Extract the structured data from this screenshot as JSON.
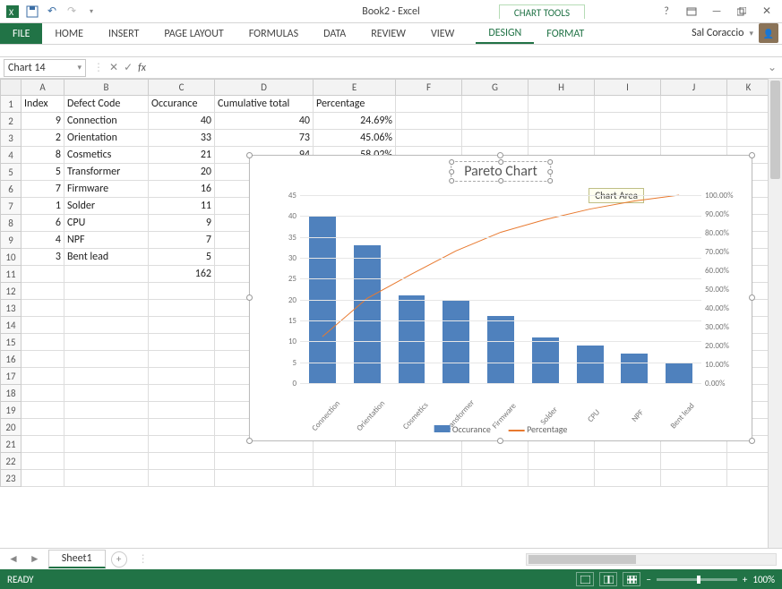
{
  "window": {
    "doc_title": "Book2 - Excel",
    "chart_tools_label": "CHART TOOLS",
    "user_name": "Sal Coraccio",
    "status_text": "READY",
    "zoom_label": "100%"
  },
  "qat": {
    "icons": [
      "excel-app-icon",
      "save-icon",
      "undo-icon",
      "redo-icon",
      "qat-more-icon"
    ]
  },
  "win_controls": [
    "help-icon",
    "ribbon-collapse-icon",
    "minimize-icon",
    "restore-icon",
    "close-icon"
  ],
  "ribbon": {
    "tabs": [
      "FILE",
      "HOME",
      "INSERT",
      "PAGE LAYOUT",
      "FORMULAS",
      "DATA",
      "REVIEW",
      "VIEW"
    ],
    "context_tabs": [
      "DESIGN",
      "FORMAT"
    ],
    "active": "DESIGN"
  },
  "namebar": {
    "name_value": "Chart 14",
    "formula_value": ""
  },
  "grid": {
    "columns": [
      {
        "letter": "A",
        "width": 48
      },
      {
        "letter": "B",
        "width": 94
      },
      {
        "letter": "C",
        "width": 74
      },
      {
        "letter": "D",
        "width": 110
      },
      {
        "letter": "E",
        "width": 92
      },
      {
        "letter": "F",
        "width": 74
      },
      {
        "letter": "G",
        "width": 74
      },
      {
        "letter": "H",
        "width": 74
      },
      {
        "letter": "I",
        "width": 74
      },
      {
        "letter": "J",
        "width": 74
      },
      {
        "letter": "K",
        "width": 48
      }
    ],
    "row_count": 23,
    "headers": {
      "A": "Index",
      "B": "Defect Code",
      "C": "Occurance",
      "D": "Cumulative total",
      "E": "Percentage"
    },
    "rows": [
      {
        "A": "9",
        "B": "Connection",
        "C": "40",
        "D": "40",
        "E": "24.69%"
      },
      {
        "A": "2",
        "B": "Orientation",
        "C": "33",
        "D": "73",
        "E": "45.06%"
      },
      {
        "A": "8",
        "B": "Cosmetics",
        "C": "21",
        "D": "94",
        "E": "58.02%"
      },
      {
        "A": "5",
        "B": "Transformer",
        "C": "20"
      },
      {
        "A": "7",
        "B": "Firmware",
        "C": "16"
      },
      {
        "A": "1",
        "B": "Solder",
        "C": "11"
      },
      {
        "A": "6",
        "B": "CPU",
        "C": "9"
      },
      {
        "A": "4",
        "B": "NPF",
        "C": "7"
      },
      {
        "A": "3",
        "B": "Bent lead",
        "C": "5"
      },
      {
        "C": "162"
      }
    ]
  },
  "chart_tooltip": "Chart Area",
  "tabstrip": {
    "sheet_name": "Sheet1"
  },
  "chart_data": {
    "type": "bar",
    "title": "Pareto Chart",
    "categories": [
      "Connection",
      "Orientation",
      "Cosmetics",
      "Transformer",
      "Firmware",
      "Solder",
      "CPU",
      "NPF",
      "Bent lead"
    ],
    "series": [
      {
        "name": "Occurance",
        "type": "bar",
        "axis": "primary",
        "values": [
          40,
          33,
          21,
          20,
          16,
          11,
          9,
          7,
          5
        ],
        "color": "#4F81BD"
      },
      {
        "name": "Percentage",
        "type": "line",
        "axis": "secondary",
        "values": [
          24.69,
          45.06,
          58.02,
          70.37,
          80.25,
          87.04,
          92.59,
          96.91,
          100.0
        ],
        "color": "#E8792F"
      }
    ],
    "ylabel": "",
    "xlabel": "",
    "y_ticks": [
      0,
      5,
      10,
      15,
      20,
      25,
      30,
      35,
      40,
      45
    ],
    "y2_ticks": [
      "0.00%",
      "10.00%",
      "20.00%",
      "30.00%",
      "40.00%",
      "50.00%",
      "60.00%",
      "70.00%",
      "80.00%",
      "90.00%",
      "100.00%"
    ],
    "ylim": [
      0,
      45
    ],
    "y2lim": [
      0,
      100
    ],
    "legend": [
      "Occurance",
      "Percentage"
    ]
  }
}
